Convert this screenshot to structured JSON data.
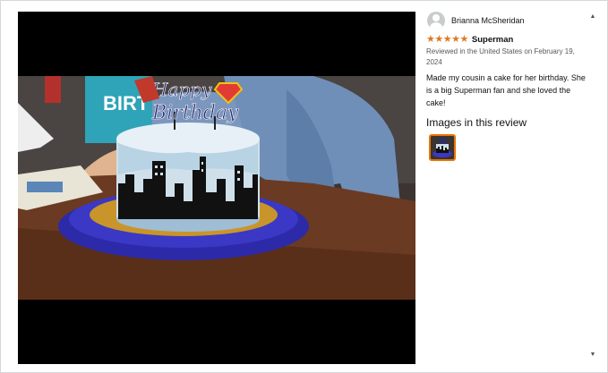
{
  "review": {
    "reviewer_name": "Brianna McSheridan",
    "avatar_icon": "default-user-avatar-icon",
    "rating": 5,
    "star_color": "#de7921",
    "stars": [
      "★",
      "★",
      "★",
      "★",
      "★"
    ],
    "title": "Superman",
    "meta": "Reviewed in the United States on February 19, 2024",
    "body": "Made my cousin a cake for her birthday. She is a big Superman fan and she loved the cake!",
    "images_heading": "Images in this review",
    "image_alt": "Birthday cake with Superman topper and city skyline"
  },
  "photo": {
    "topper_line1": "Happy",
    "topper_line2": "Birthday",
    "bag_text": "BIRT"
  },
  "scrollbar": {
    "up_icon": "▲",
    "down_icon": "▼"
  }
}
